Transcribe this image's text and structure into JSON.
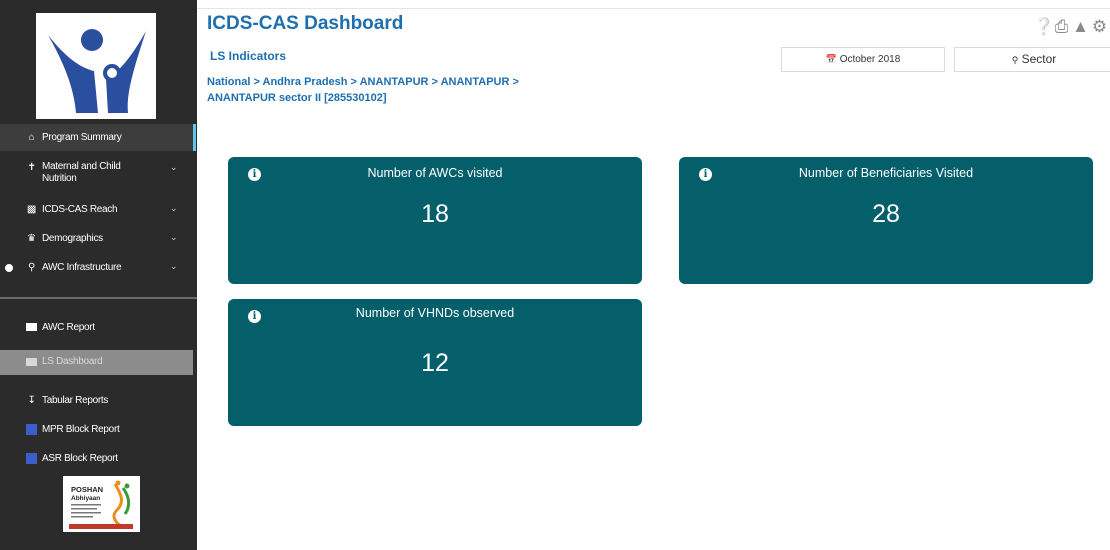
{
  "header": {
    "title": "ICDS-CAS Dashboard",
    "subtitle": "LS Indicators",
    "breadcrumb_line1": "National > Andhra Pradesh > ANANTAPUR > ANANTAPUR >",
    "breadcrumb_line2": "ANANTAPUR sector II [285530102]",
    "icons": [
      "help-icon",
      "print-icon",
      "warning-icon",
      "settings-icon"
    ]
  },
  "filters": {
    "date": "October 2018",
    "location": "Sector"
  },
  "sidebar": {
    "items": [
      {
        "label": "Program Summary",
        "icon": "home-icon"
      },
      {
        "label": "Maternal and Child",
        "label2": "Nutrition",
        "icon": "child-icon"
      },
      {
        "label": "ICDS-CAS Reach",
        "icon": "chart-icon"
      },
      {
        "label": "Demographics",
        "icon": "users-icon"
      },
      {
        "label": "AWC Infrastructure",
        "icon": "location-icon"
      }
    ],
    "reports": [
      {
        "label": "AWC Report",
        "icon": "document-icon"
      },
      {
        "label": "LS Dashboard",
        "icon": "dashboard-icon"
      },
      {
        "label": "Tabular Reports",
        "icon": "download-icon"
      },
      {
        "label": "MPR Block Report",
        "icon": "report-icon"
      },
      {
        "label": "ASR Block Report",
        "icon": "report-icon"
      }
    ],
    "poshan_logo_text": "POSHAN Abhiyaan"
  },
  "cards": [
    {
      "title": "Number of AWCs visited",
      "value": "18"
    },
    {
      "title": "Number of  Beneficiaries Visited",
      "value": "28"
    },
    {
      "title": "Number of VHNDs observed",
      "value": "12"
    }
  ],
  "colors": {
    "card_bg": "#045f6b",
    "title_blue": "#1e6fb0",
    "sidebar_bg": "#2b2b2b",
    "active_accent": "#5ec6e8"
  }
}
